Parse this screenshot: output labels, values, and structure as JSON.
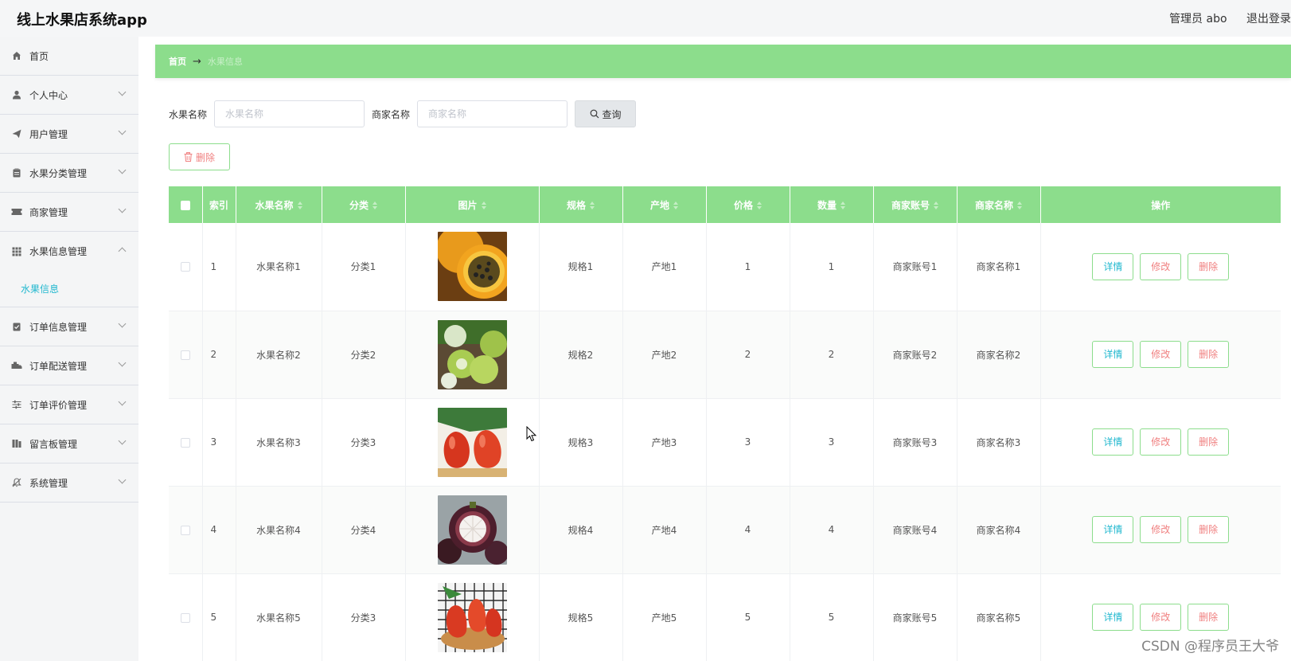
{
  "app": {
    "title": "线上水果店系统app",
    "user_label": "管理员 abo",
    "logout_label": "退出登录"
  },
  "sidebar": {
    "items": [
      {
        "label": "首页",
        "icon": "home-icon",
        "expandable": false
      },
      {
        "label": "个人中心",
        "icon": "user-icon",
        "expandable": true
      },
      {
        "label": "用户管理",
        "icon": "send-icon",
        "expandable": true
      },
      {
        "label": "水果分类管理",
        "icon": "clipboard-icon",
        "expandable": true
      },
      {
        "label": "商家管理",
        "icon": "ticket-icon",
        "expandable": true
      },
      {
        "label": "水果信息管理",
        "icon": "grid-icon",
        "expandable": true,
        "expanded": true,
        "submenu": "水果信息"
      },
      {
        "label": "订单信息管理",
        "icon": "order-icon",
        "expandable": true
      },
      {
        "label": "订单配送管理",
        "icon": "delivery-icon",
        "expandable": true
      },
      {
        "label": "订单评价管理",
        "icon": "sliders-icon",
        "expandable": true
      },
      {
        "label": "留言板管理",
        "icon": "message-icon",
        "expandable": true
      },
      {
        "label": "系统管理",
        "icon": "bell-off-icon",
        "expandable": true
      }
    ]
  },
  "breadcrumb": {
    "home": "首页",
    "separator": "→",
    "current": "水果信息"
  },
  "search": {
    "fruit_name_label": "水果名称",
    "fruit_name_placeholder": "水果名称",
    "merchant_name_label": "商家名称",
    "merchant_name_placeholder": "商家名称",
    "query_button": "查询"
  },
  "toolbar": {
    "delete_label": "删除"
  },
  "table": {
    "columns": [
      "索引",
      "水果名称",
      "分类",
      "图片",
      "规格",
      "产地",
      "价格",
      "数量",
      "商家账号",
      "商家名称",
      "操作"
    ],
    "rows": [
      {
        "index": "1",
        "name": "水果名称1",
        "category": "分类1",
        "image": "passion-fruit",
        "spec": "规格1",
        "origin": "产地1",
        "price": "1",
        "qty": "1",
        "merchant_account": "商家账号1",
        "merchant_name": "商家名称1"
      },
      {
        "index": "2",
        "name": "水果名称2",
        "category": "分类2",
        "image": "green-dates",
        "spec": "规格2",
        "origin": "产地2",
        "price": "2",
        "qty": "2",
        "merchant_account": "商家账号2",
        "merchant_name": "商家名称2"
      },
      {
        "index": "3",
        "name": "水果名称3",
        "category": "分类3",
        "image": "wax-apple",
        "spec": "规格3",
        "origin": "产地3",
        "price": "3",
        "qty": "3",
        "merchant_account": "商家账号3",
        "merchant_name": "商家名称3"
      },
      {
        "index": "4",
        "name": "水果名称4",
        "category": "分类4",
        "image": "mangosteen",
        "spec": "规格4",
        "origin": "产地4",
        "price": "4",
        "qty": "4",
        "merchant_account": "商家账号4",
        "merchant_name": "商家名称4"
      },
      {
        "index": "5",
        "name": "水果名称5",
        "category": "分类3",
        "image": "wax-apple-bowl",
        "spec": "规格5",
        "origin": "产地5",
        "price": "5",
        "qty": "5",
        "merchant_account": "商家账号5",
        "merchant_name": "商家名称5"
      }
    ],
    "actions": {
      "detail": "详情",
      "edit": "修改",
      "delete": "删除"
    }
  },
  "watermark": "CSDN @程序员王大爷",
  "colors": {
    "accent_green": "#8cdd8c",
    "link_cyan": "#22b8cf",
    "danger_pink": "#f08080"
  }
}
